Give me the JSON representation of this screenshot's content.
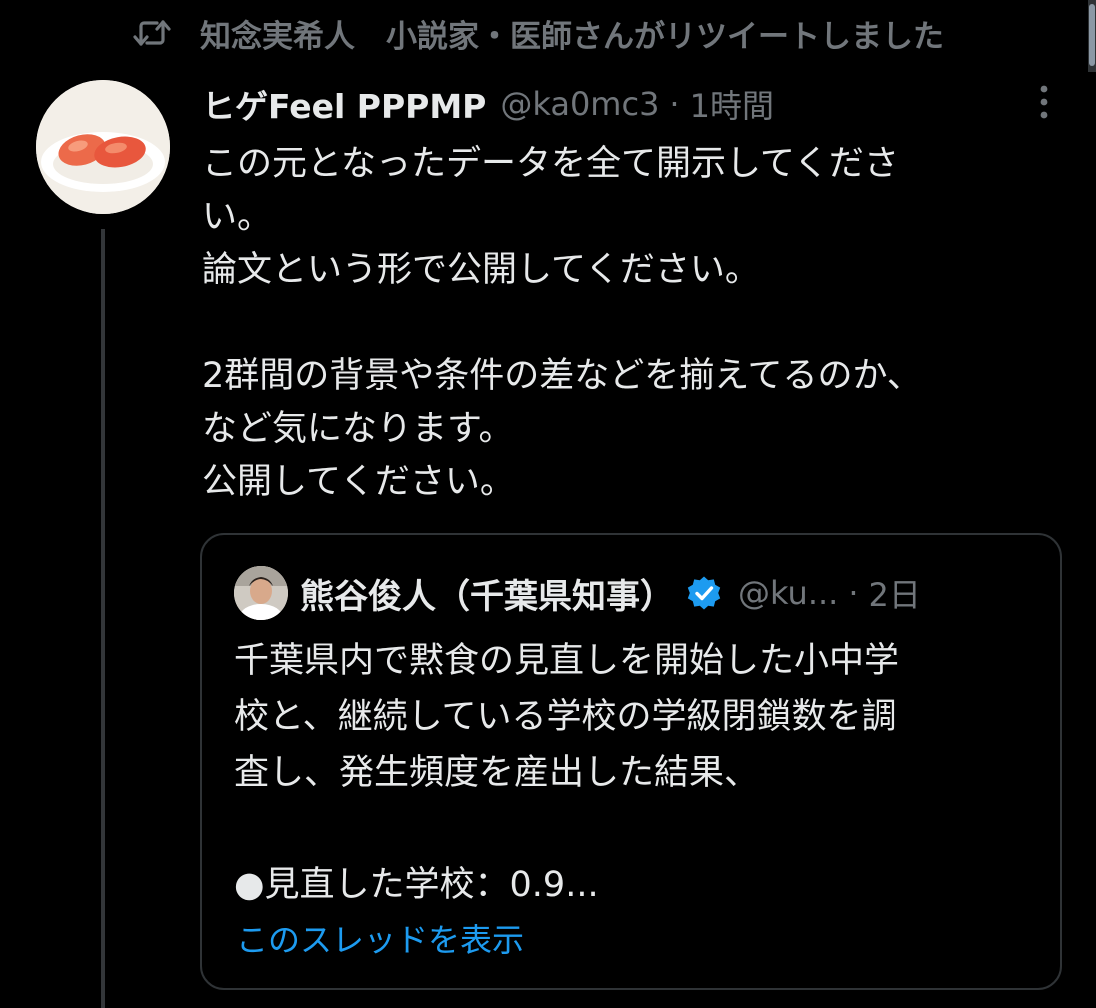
{
  "retweet": {
    "icon": "retweet-icon",
    "text": "知念実希人　小説家・医師さんがリツイートしました"
  },
  "tweet": {
    "avatar_icon": "mentaiko-avatar",
    "display_name": "ヒゲFeel PPPMP",
    "handle": "@ka0mc3",
    "separator": "·",
    "time": "1時間",
    "more_icon": "more-vertical-icon",
    "lines": [
      "この元となったデータを全て開示してくださ",
      "い。",
      "論文という形で公開してください。",
      "",
      "2群間の背景や条件の差などを揃えてるのか、",
      "など気になります。",
      "公開してください。"
    ]
  },
  "quote": {
    "avatar_icon": "person-avatar",
    "display_name": "熊谷俊人（千葉県知事）",
    "verified_icon": "verified-badge-icon",
    "handle": "@ku...",
    "separator": "·",
    "time": "2日",
    "lines": [
      "千葉県内で黙食の見直しを開始した小中学",
      "校と、継続している学校の学級閉鎖数を調",
      "査し、発生頻度を産出した結果、",
      "",
      "●見直した学校：0.9..."
    ],
    "show_thread": "このスレッドを表示"
  },
  "colors": {
    "background": "#000000",
    "primary_text": "#e7e9ea",
    "secondary_text": "#71767b",
    "link": "#1d9bf0",
    "border": "#2f3336"
  }
}
